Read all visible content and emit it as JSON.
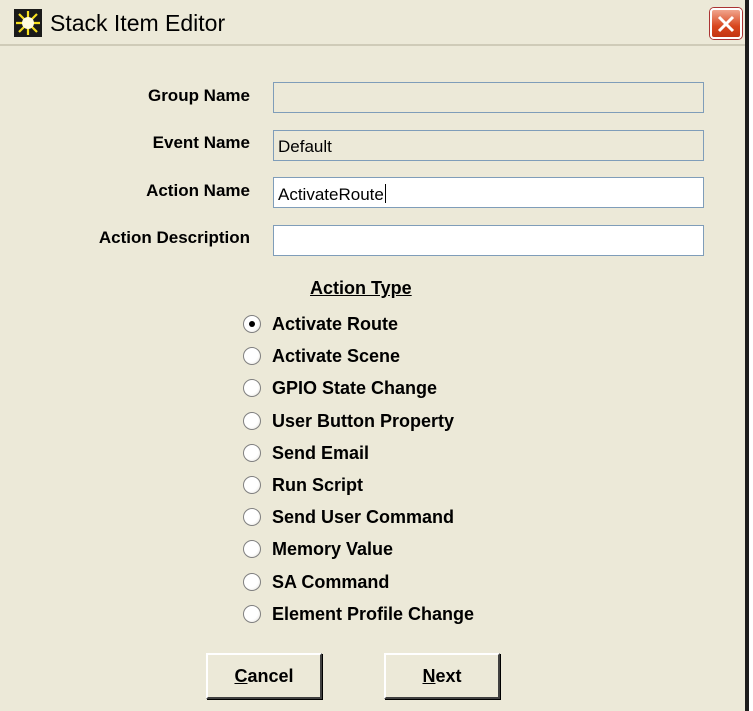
{
  "window": {
    "title": "Stack Item Editor",
    "icon": "sun-burst-icon",
    "close_icon": "close-icon"
  },
  "form": {
    "group_name": {
      "label": "Group Name",
      "value": ""
    },
    "event_name": {
      "label": "Event Name",
      "value": "Default"
    },
    "action_name": {
      "label": "Action Name",
      "value": "ActivateRoute"
    },
    "action_description": {
      "label": "Action Description",
      "value": ""
    }
  },
  "action_type": {
    "title": "Action Type",
    "selected": "Activate Route",
    "options": [
      {
        "label": "Activate Route"
      },
      {
        "label": "Activate Scene"
      },
      {
        "label": "GPIO State Change"
      },
      {
        "label": "User Button Property"
      },
      {
        "label": "Send Email"
      },
      {
        "label": "Run Script"
      },
      {
        "label": "Send User Command"
      },
      {
        "label": "Memory Value"
      },
      {
        "label": "SA Command"
      },
      {
        "label": "Element Profile Change"
      }
    ]
  },
  "buttons": {
    "cancel": {
      "first": "C",
      "rest": "ancel"
    },
    "next": {
      "first": "N",
      "rest": "ext"
    }
  },
  "colors": {
    "dialog_bg": "#ece9d8",
    "close_button": "#d8471f",
    "field_border": "#7f9db9"
  }
}
